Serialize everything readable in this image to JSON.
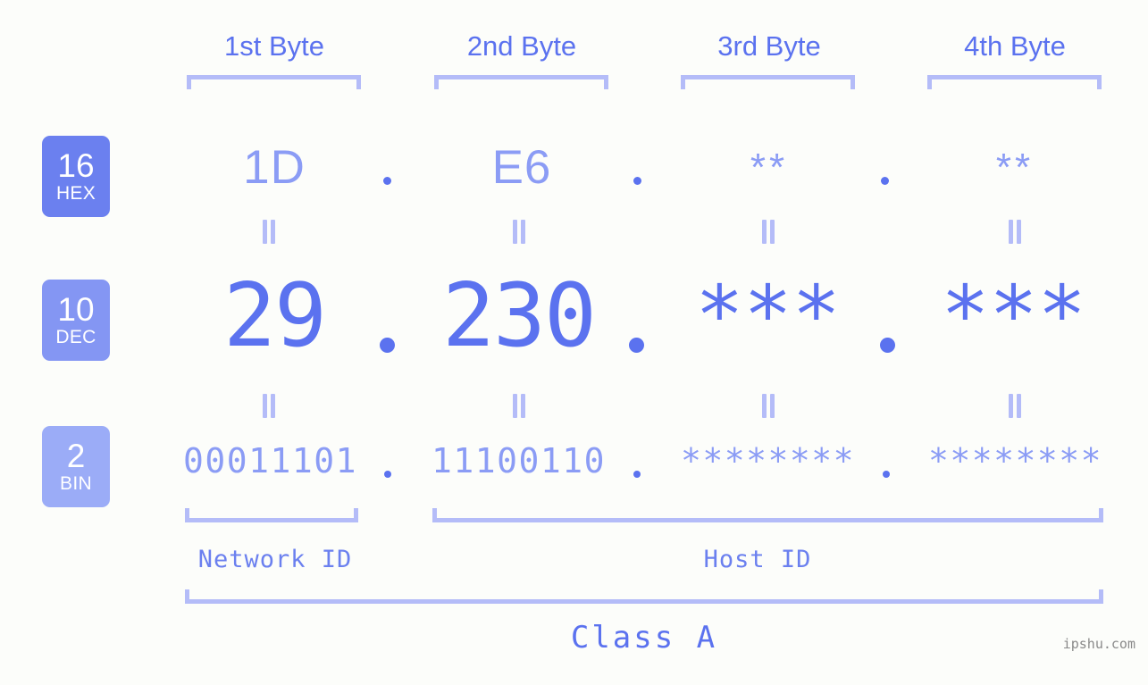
{
  "theme": {
    "background": "#fcfdfa",
    "accent_strong": "#5b72ef",
    "accent_mid": "#8b9cf5",
    "accent_light": "#b4bcf8",
    "badge_hex": "#6b80ef",
    "badge_dec": "#8496f3",
    "badge_bin": "#9bacf7",
    "watermark_color": "#8a8a8a"
  },
  "byte_headers": [
    {
      "label": "1st Byte"
    },
    {
      "label": "2nd Byte"
    },
    {
      "label": "3rd Byte"
    },
    {
      "label": "4th Byte"
    }
  ],
  "bases": [
    {
      "number": "16",
      "name": "HEX"
    },
    {
      "number": "10",
      "name": "DEC"
    },
    {
      "number": "2",
      "name": "BIN"
    }
  ],
  "rows": {
    "hex": {
      "base_number": "16",
      "base_name": "HEX",
      "octets": [
        "1D",
        "E6",
        "**",
        "**"
      ]
    },
    "dec": {
      "base_number": "10",
      "base_name": "DEC",
      "octets": [
        "29",
        "230",
        "***",
        "***"
      ]
    },
    "bin": {
      "base_number": "2",
      "base_name": "BIN",
      "octets": [
        "00011101",
        "11100110",
        "********",
        "********"
      ]
    }
  },
  "separators": {
    "dot": ".",
    "equals": "="
  },
  "segments": [
    {
      "label": "Network ID"
    },
    {
      "label": "Host ID"
    }
  ],
  "class_label": "Class A",
  "watermark": "ipshu.com"
}
